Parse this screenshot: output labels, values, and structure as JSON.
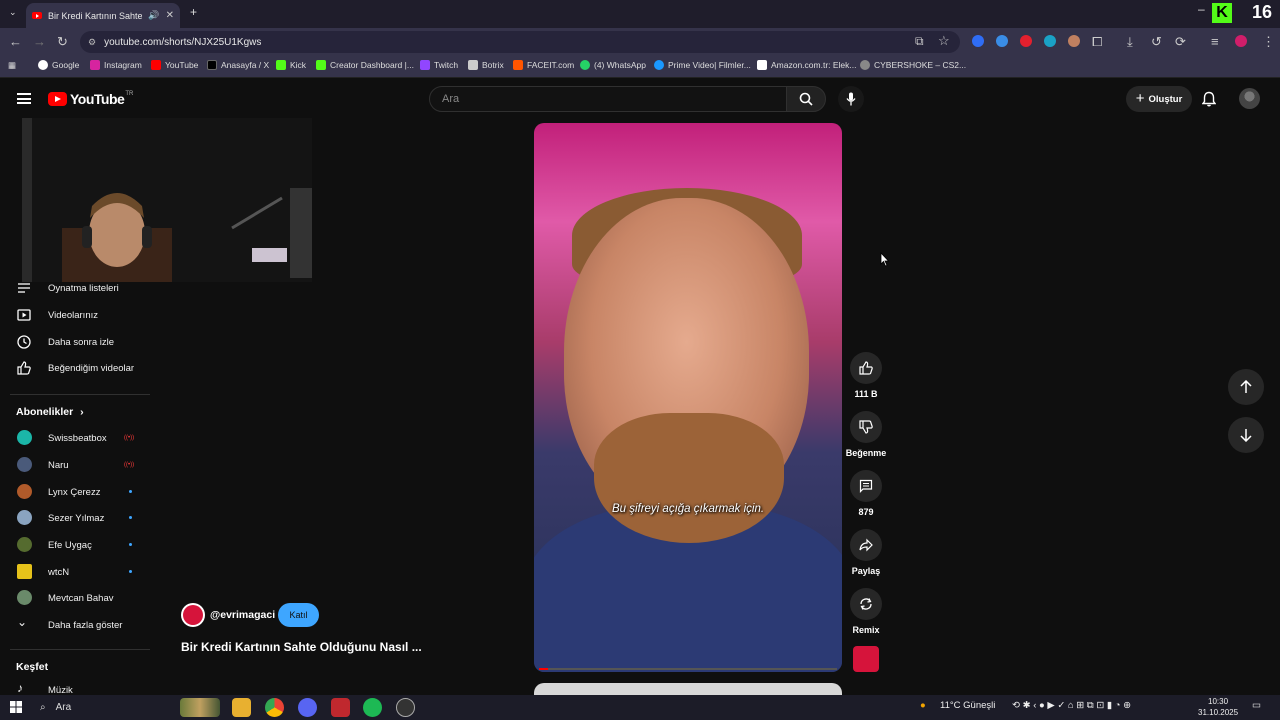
{
  "browser": {
    "tab_title": "Bir Kredi Kartının Sahte Old",
    "url": "youtube.com/shorts/NJX25U1Kgws",
    "kick_badge": "K",
    "kick_count": "16",
    "bookmarks": [
      "Google",
      "Instagram",
      "YouTube",
      "Anasayfa / X",
      "Kick",
      "Creator Dashboard |...",
      "Twitch",
      "Botrix",
      "FACEIT.com",
      "(4) WhatsApp",
      "Prime Video| Filmler...",
      "Amazon.com.tr: Elek...",
      "CYBERSHOKE – CS2..."
    ]
  },
  "header": {
    "logo_text": "YouTube",
    "logo_region": "TR",
    "search_placeholder": "Ara",
    "create_label": "Oluştur"
  },
  "sidebar": {
    "you_items": [
      "Oynatma listeleri",
      "Videolarınız",
      "Daha sonra izle",
      "Beğendiğim videolar"
    ],
    "subs_heading": "Abonelikler",
    "subscriptions": [
      {
        "name": "Swissbeatbox",
        "status": "live",
        "color": "#1bb6a8"
      },
      {
        "name": "Naru",
        "status": "live",
        "color": "#4a5a7a"
      },
      {
        "name": "Lynx Çerezz",
        "status": "new",
        "color": "#b05a2a"
      },
      {
        "name": "Sezer Yılmaz",
        "status": "new",
        "color": "#8aa4c0"
      },
      {
        "name": "Efe Uygaç",
        "status": "new",
        "color": "#556b2f"
      },
      {
        "name": "wtcN",
        "status": "new",
        "color": "#e6c21a"
      },
      {
        "name": "Mevtcan Bahav",
        "status": "",
        "color": "#6a8a6a"
      }
    ],
    "show_more": "Daha fazla göster",
    "explore_heading": "Keşfet",
    "explore_items": [
      "Müzik"
    ]
  },
  "short": {
    "caption": "Bu şifreyi açığa çıkarmak için.",
    "channel_handle": "@evrimagaci",
    "join_label": "Katıl",
    "title": "Bir Kredi Kartının Sahte Olduğunu Nasıl ...",
    "progress": 0.03
  },
  "actions": {
    "likes": "111 B",
    "dislike_label": "Beğenme",
    "comments": "879",
    "share_label": "Paylaş",
    "remix_label": "Remix"
  },
  "taskbar": {
    "search_label": "Ara",
    "weather": "11°C  Güneşli",
    "time": "10:30",
    "date": "31.10.2025"
  }
}
